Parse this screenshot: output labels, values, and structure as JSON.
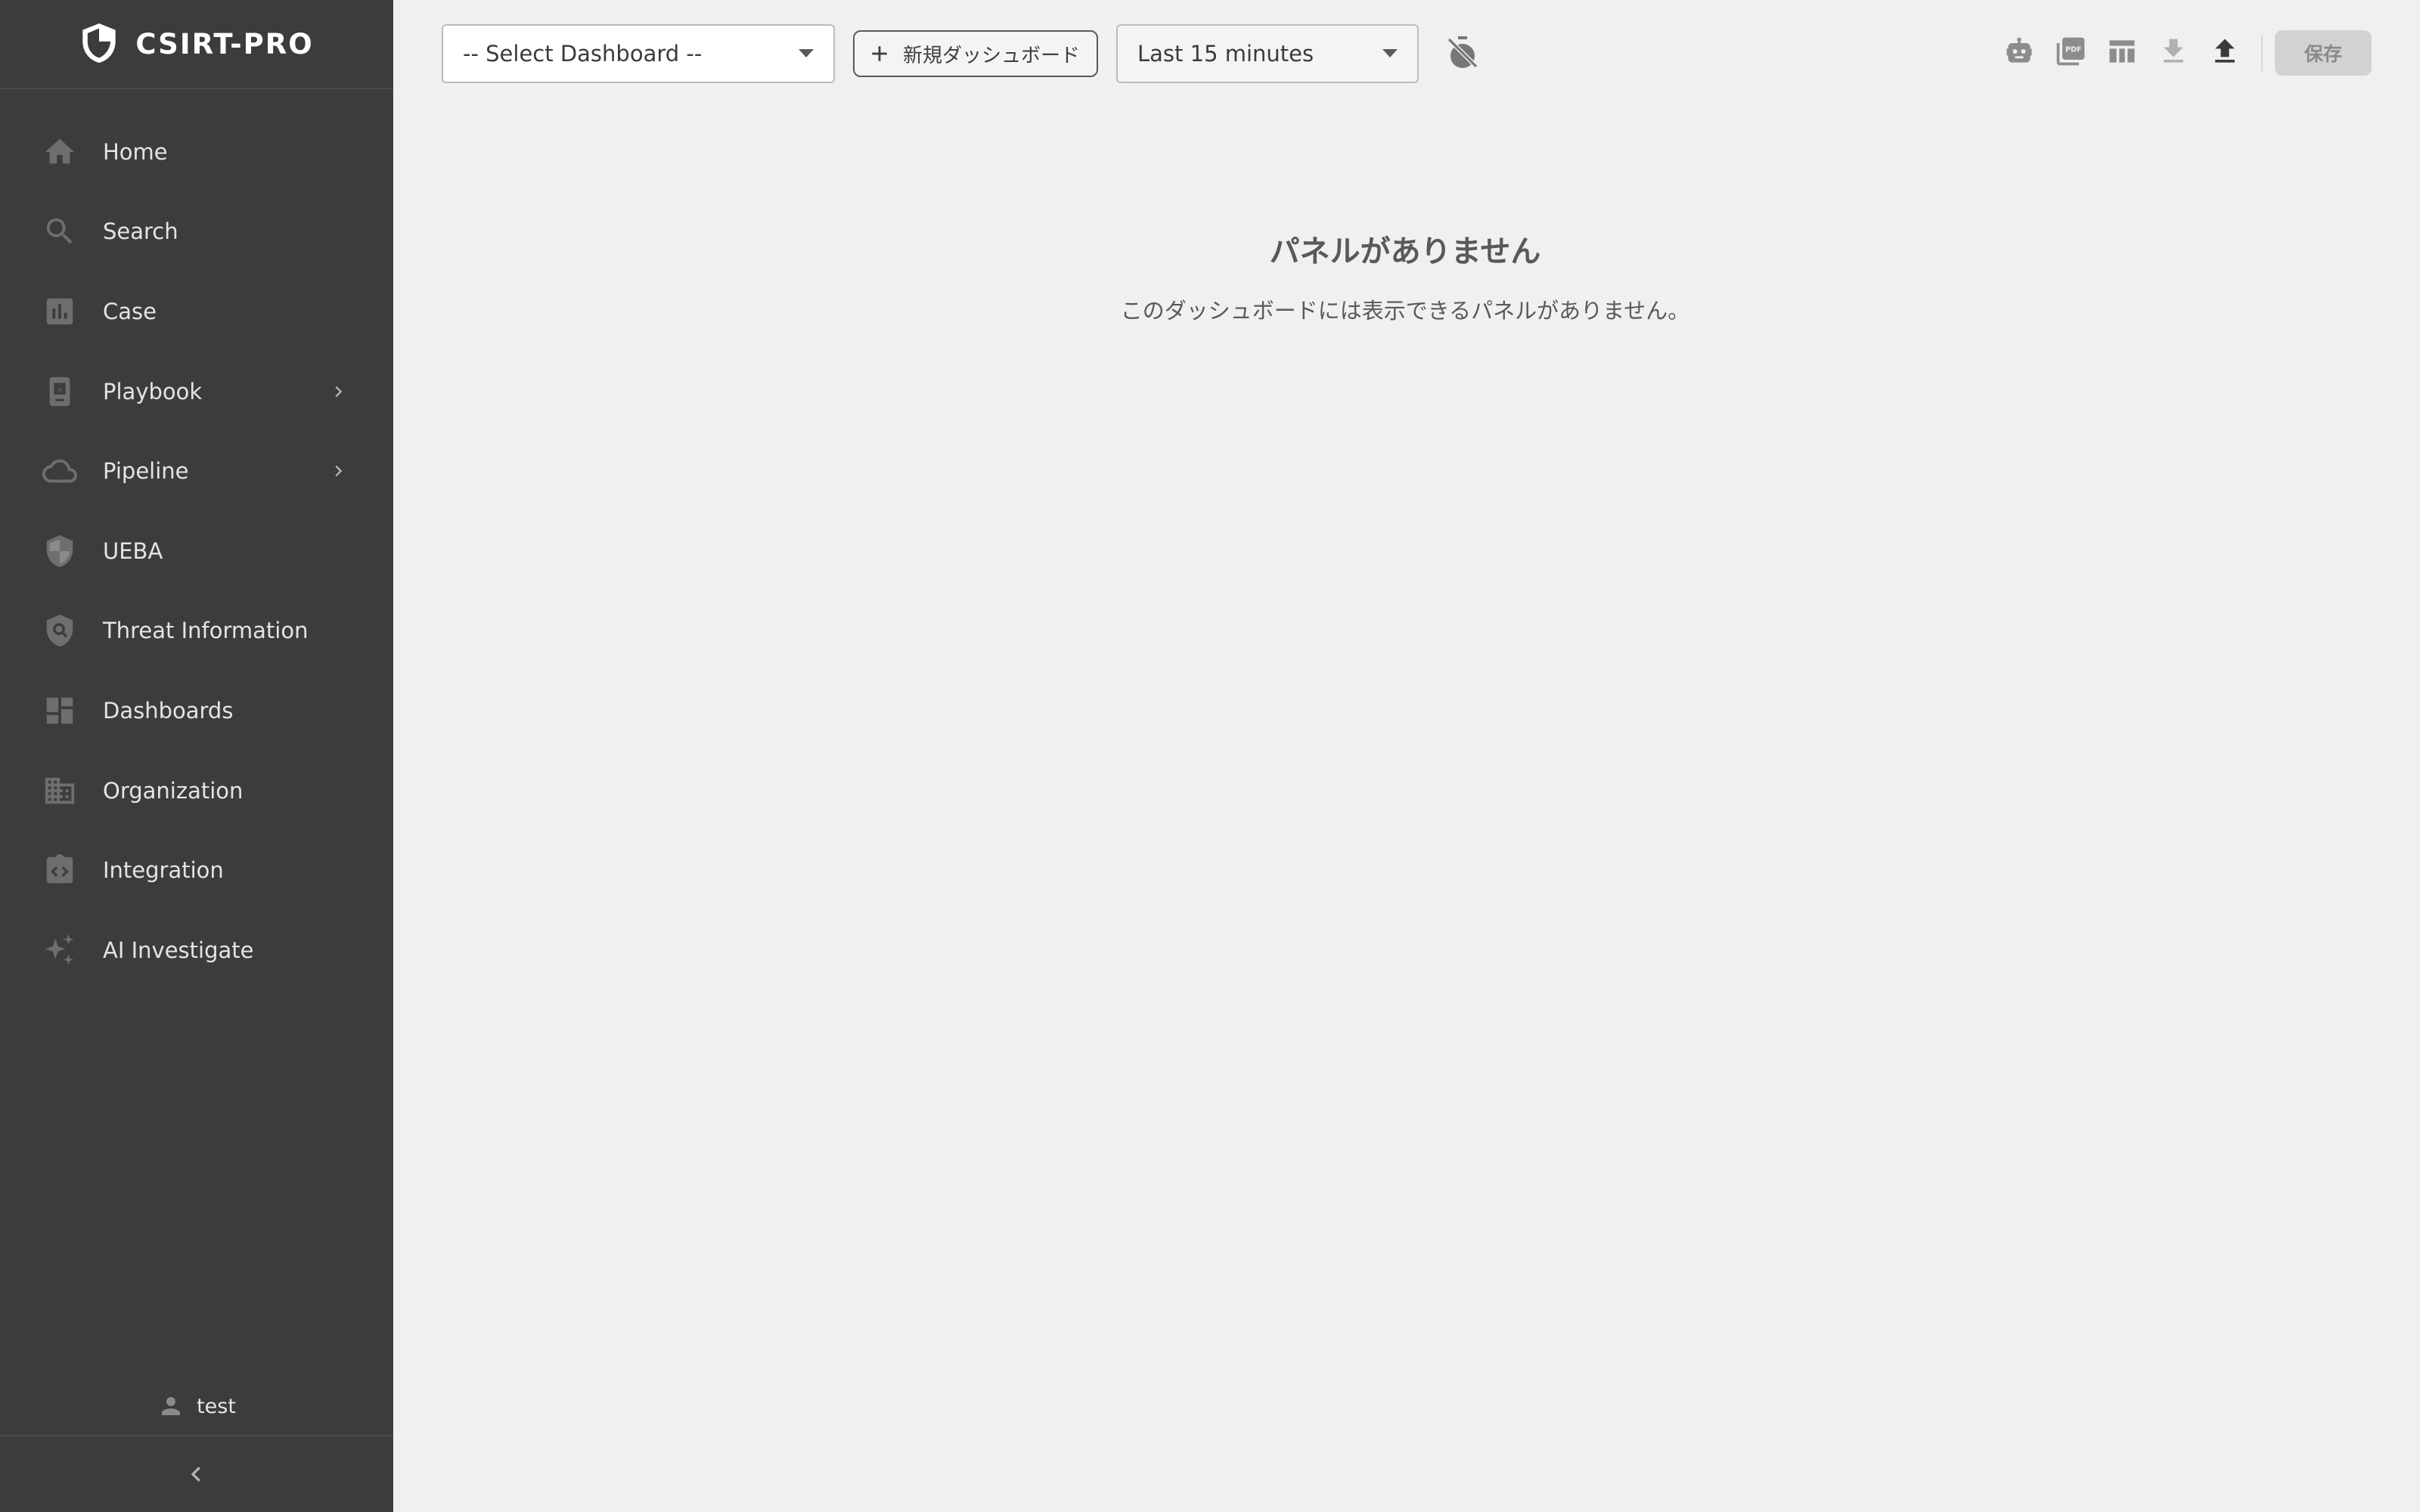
{
  "app": {
    "brand": "CSIRT-PRO",
    "colors": {
      "sidebar_bg": "#3d3c3c",
      "content_bg": "#f0f0f0",
      "sidebar_text": "#e4e4e4",
      "icon_gray": "#6e6e6e"
    }
  },
  "sidebar": {
    "items": [
      {
        "label": "Home",
        "icon": "home-icon"
      },
      {
        "label": "Search",
        "icon": "search-icon"
      },
      {
        "label": "Case",
        "icon": "bar-chart-icon"
      },
      {
        "label": "Playbook",
        "icon": "playbook-icon",
        "has_submenu": true
      },
      {
        "label": "Pipeline",
        "icon": "cloud-icon",
        "has_submenu": true
      },
      {
        "label": "UEBA",
        "icon": "shield-icon"
      },
      {
        "label": "Threat Information",
        "icon": "shield-search-icon"
      },
      {
        "label": "Dashboards",
        "icon": "dashboard-icon"
      },
      {
        "label": "Organization",
        "icon": "building-icon"
      },
      {
        "label": "Integration",
        "icon": "integration-icon"
      },
      {
        "label": "AI Investigate",
        "icon": "sparkle-icon"
      }
    ],
    "user": {
      "name": "test"
    }
  },
  "toolbar": {
    "dashboard_select": {
      "value": "-- Select Dashboard --"
    },
    "new_dashboard_label": "新規ダッシュボード",
    "time_range": {
      "value": "Last 15 minutes"
    },
    "save_label": "保存",
    "icons": [
      "timer-off-icon",
      "robot-icon",
      "pdf-icon",
      "table-icon",
      "download-icon",
      "upload-icon"
    ]
  },
  "empty_state": {
    "title": "パネルがありません",
    "description": "このダッシュボードには表示できるパネルがありません。"
  }
}
